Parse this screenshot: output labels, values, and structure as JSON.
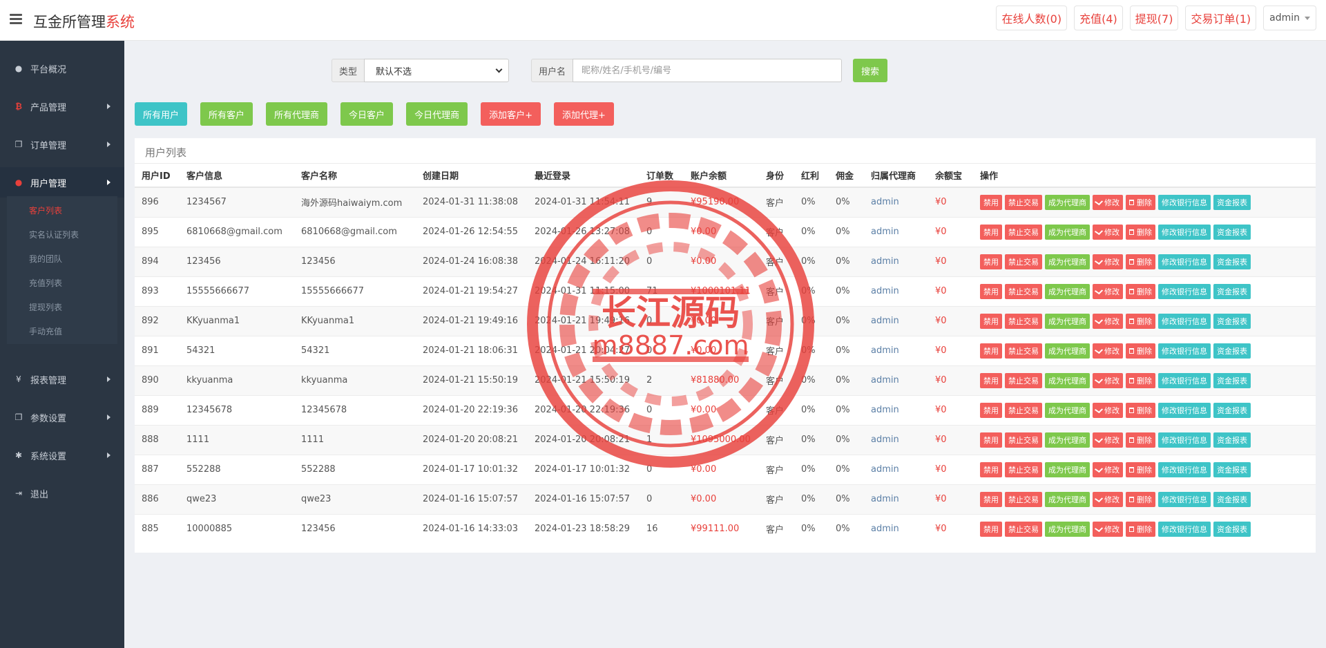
{
  "brand": {
    "main": "互金所管理",
    "accent": "系统"
  },
  "top_right": [
    {
      "label": "在线人数(0)"
    },
    {
      "label": "充值(4)"
    },
    {
      "label": "提现(7)"
    },
    {
      "label": "交易订单(1)"
    }
  ],
  "admin_label": "admin",
  "sidebar": {
    "items": [
      {
        "label": "平台概况",
        "icon": "dashboard-icon"
      },
      {
        "label": "产品管理",
        "icon": "bitcoin-icon"
      },
      {
        "label": "订单管理",
        "icon": "copy-icon"
      },
      {
        "label": "用户管理",
        "icon": "user-icon"
      },
      {
        "label": "报表管理",
        "icon": "yen-icon",
        "glyph": "¥"
      },
      {
        "label": "参数设置",
        "icon": "copy-icon"
      },
      {
        "label": "系统设置",
        "icon": "gears-icon"
      },
      {
        "label": "退出",
        "icon": "sign-out-icon"
      }
    ],
    "submenu": [
      {
        "label": "客户列表"
      },
      {
        "label": "实名认证列表"
      },
      {
        "label": "我的团队"
      },
      {
        "label": "充值列表"
      },
      {
        "label": "提现列表"
      },
      {
        "label": "手动充值"
      }
    ]
  },
  "search": {
    "type_label": "类型",
    "type_value": "默认不选",
    "name_label": "用户名",
    "name_placeholder": "昵称/姓名/手机号/编号",
    "search_button": "搜索"
  },
  "filters": [
    {
      "label": "所有用户"
    },
    {
      "label": "所有客户"
    },
    {
      "label": "所有代理商"
    },
    {
      "label": "今日客户"
    },
    {
      "label": "今日代理商"
    },
    {
      "label": "添加客户+"
    },
    {
      "label": "添加代理+"
    }
  ],
  "table": {
    "title": "用户列表",
    "columns": [
      "用户ID",
      "客户信息",
      "客户名称",
      "创建日期",
      "最近登录",
      "订单数",
      "账户余额",
      "身份",
      "红利",
      "佣金",
      "归属代理商",
      "余额宝",
      "操作"
    ],
    "rows": [
      {
        "id": "896",
        "info": "1234567",
        "name": "海外源码haiwaiym.com",
        "created": "2024-01-31 11:38:08",
        "login": "2024-01-31 11:54:11",
        "orders": "9",
        "balance": "¥95190.00",
        "role": "客户",
        "bonus": "0%",
        "commission": "0%",
        "agent": "admin",
        "yuebao": "¥0"
      },
      {
        "id": "895",
        "info": "6810668@gmail.com",
        "name": "6810668@gmail.com",
        "created": "2024-01-26 12:54:55",
        "login": "2024-01-26 13:27:08",
        "orders": "0",
        "balance": "¥0.00",
        "role": "客户",
        "bonus": "0%",
        "commission": "0%",
        "agent": "admin",
        "yuebao": "¥0"
      },
      {
        "id": "894",
        "info": "123456",
        "name": "123456",
        "created": "2024-01-24 16:08:38",
        "login": "2024-01-24 16:11:20",
        "orders": "0",
        "balance": "¥0.00",
        "role": "客户",
        "bonus": "0%",
        "commission": "0%",
        "agent": "admin",
        "yuebao": "¥0"
      },
      {
        "id": "893",
        "info": "15555666677",
        "name": "15555666677",
        "created": "2024-01-21 19:54:27",
        "login": "2024-01-31 11:15:00",
        "orders": "71",
        "balance": "¥1000101.11",
        "role": "客户",
        "bonus": "0%",
        "commission": "0%",
        "agent": "admin",
        "yuebao": "¥0"
      },
      {
        "id": "892",
        "info": "KKyuanma1",
        "name": "KKyuanma1",
        "created": "2024-01-21 19:49:16",
        "login": "2024-01-21 19:49:16",
        "orders": "0",
        "balance": "¥0.00",
        "role": "客户",
        "bonus": "0%",
        "commission": "0%",
        "agent": "admin",
        "yuebao": "¥0"
      },
      {
        "id": "891",
        "info": "54321",
        "name": "54321",
        "created": "2024-01-21 18:06:31",
        "login": "2024-01-21 20:04:27",
        "orders": "0",
        "balance": "¥0.00",
        "role": "客户",
        "bonus": "0%",
        "commission": "0%",
        "agent": "admin",
        "yuebao": "¥0"
      },
      {
        "id": "890",
        "info": "kkyuanma",
        "name": "kkyuanma",
        "created": "2024-01-21 15:50:19",
        "login": "2024-01-21 15:50:19",
        "orders": "2",
        "balance": "¥81880.00",
        "role": "客户",
        "bonus": "0%",
        "commission": "0%",
        "agent": "admin",
        "yuebao": "¥0"
      },
      {
        "id": "889",
        "info": "12345678",
        "name": "12345678",
        "created": "2024-01-20 22:19:36",
        "login": "2024-01-20 22:19:36",
        "orders": "0",
        "balance": "¥0.00",
        "role": "客户",
        "bonus": "0%",
        "commission": "0%",
        "agent": "admin",
        "yuebao": "¥0"
      },
      {
        "id": "888",
        "info": "1111",
        "name": "1111",
        "created": "2024-01-20 20:08:21",
        "login": "2024-01-20 20:08:21",
        "orders": "1",
        "balance": "¥1095000.00",
        "role": "客户",
        "bonus": "0%",
        "commission": "0%",
        "agent": "admin",
        "yuebao": "¥0"
      },
      {
        "id": "887",
        "info": "552288",
        "name": "552288",
        "created": "2024-01-17 10:01:32",
        "login": "2024-01-17 10:01:32",
        "orders": "0",
        "balance": "¥0.00",
        "role": "客户",
        "bonus": "0%",
        "commission": "0%",
        "agent": "admin",
        "yuebao": "¥0"
      },
      {
        "id": "886",
        "info": "qwe23",
        "name": "qwe23",
        "created": "2024-01-16 15:07:57",
        "login": "2024-01-16 15:07:57",
        "orders": "0",
        "balance": "¥0.00",
        "role": "客户",
        "bonus": "0%",
        "commission": "0%",
        "agent": "admin",
        "yuebao": "¥0"
      },
      {
        "id": "885",
        "info": "10000885",
        "name": "123456",
        "created": "2024-01-16 14:33:03",
        "login": "2024-01-23 18:58:29",
        "orders": "16",
        "balance": "¥99111.00",
        "role": "客户",
        "bonus": "0%",
        "commission": "0%",
        "agent": "admin",
        "yuebao": "¥0"
      }
    ],
    "actions": {
      "disable": "禁用",
      "ban_trade": "禁止交易",
      "make_agent": "成为代理商",
      "edit": "修改",
      "delete": "删除",
      "edit_bank": "修改银行信息",
      "fund_report": "资金报表"
    }
  },
  "watermark": {
    "title": "长江源码",
    "url": "m8887.com"
  },
  "colors": {
    "accent_red": "#e8403b",
    "green": "#7ec84c",
    "teal": "#3ec4c7",
    "sidebar_bg": "#2b3643"
  }
}
